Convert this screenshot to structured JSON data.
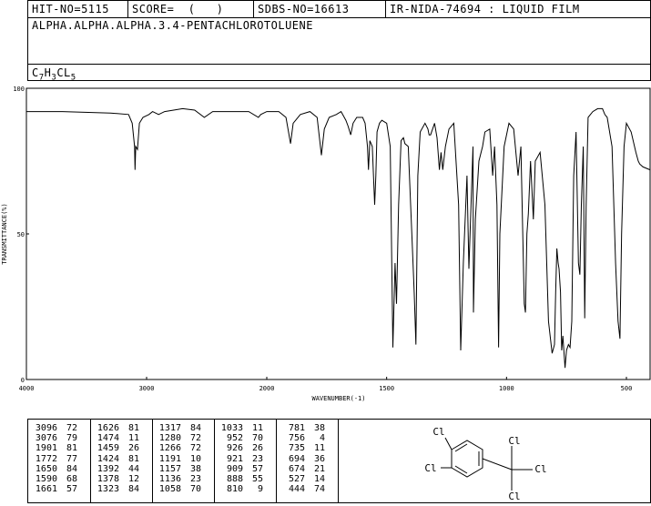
{
  "header": {
    "hit_no": "HIT-NO=5115",
    "score": "SCORE=  (   )",
    "sdbs_no": "SDBS-NO=16613",
    "ir_nida": "IR-NIDA-74694 : LIQUID FILM"
  },
  "compound_name": "ALPHA.ALPHA.ALPHA.3.4-PENTACHLOROTOLUENE",
  "formula": {
    "c": "C",
    "c_n": "7",
    "h": "H",
    "h_n": "3",
    "cl": "CL",
    "cl_n": "5"
  },
  "chart_data": {
    "type": "line",
    "xlabel": "WAVENUMBER(-1)",
    "ylabel": "TRANSMITTANCE(%)",
    "xlim": [
      4000,
      400
    ],
    "ylim": [
      0,
      100
    ],
    "x_ticks": [
      4000,
      3000,
      2000,
      1500,
      1000,
      500
    ],
    "y_ticks": [
      0,
      50,
      100
    ],
    "x_tick_labels": [
      "4000",
      "3000",
      "2000",
      "1500",
      "1000",
      "500"
    ],
    "y_tick_labels": [
      "0",
      "50",
      "100"
    ],
    "series": [
      {
        "points": [
          [
            4000,
            92
          ],
          [
            3700,
            92
          ],
          [
            3300,
            91.5
          ],
          [
            3150,
            91
          ],
          [
            3120,
            88
          ],
          [
            3100,
            80
          ],
          [
            3096,
            72
          ],
          [
            3090,
            80
          ],
          [
            3076,
            79
          ],
          [
            3060,
            88
          ],
          [
            3030,
            90
          ],
          [
            2980,
            91
          ],
          [
            2950,
            92
          ],
          [
            2900,
            91
          ],
          [
            2850,
            92
          ],
          [
            2700,
            93
          ],
          [
            2600,
            92.5
          ],
          [
            2520,
            90
          ],
          [
            2450,
            92
          ],
          [
            2300,
            92
          ],
          [
            2150,
            92
          ],
          [
            2070,
            90
          ],
          [
            2050,
            91
          ],
          [
            2000,
            92
          ],
          [
            1950,
            92
          ],
          [
            1920,
            90
          ],
          [
            1901,
            81
          ],
          [
            1890,
            88
          ],
          [
            1860,
            91
          ],
          [
            1820,
            92
          ],
          [
            1790,
            90
          ],
          [
            1772,
            77
          ],
          [
            1760,
            86
          ],
          [
            1740,
            90
          ],
          [
            1710,
            91
          ],
          [
            1690,
            92
          ],
          [
            1670,
            89
          ],
          [
            1661,
            87
          ],
          [
            1650,
            84
          ],
          [
            1640,
            88
          ],
          [
            1625,
            90
          ],
          [
            1600,
            90
          ],
          [
            1590,
            88
          ],
          [
            1580,
            80
          ],
          [
            1576,
            72
          ],
          [
            1570,
            82
          ],
          [
            1560,
            80
          ],
          [
            1550,
            60
          ],
          [
            1545,
            70
          ],
          [
            1540,
            85
          ],
          [
            1530,
            88
          ],
          [
            1520,
            89
          ],
          [
            1500,
            88
          ],
          [
            1485,
            80
          ],
          [
            1474,
            11
          ],
          [
            1465,
            40
          ],
          [
            1459,
            26
          ],
          [
            1450,
            60
          ],
          [
            1440,
            82
          ],
          [
            1430,
            83
          ],
          [
            1424,
            81
          ],
          [
            1410,
            80
          ],
          [
            1400,
            60
          ],
          [
            1392,
            44
          ],
          [
            1385,
            30
          ],
          [
            1378,
            12
          ],
          [
            1370,
            70
          ],
          [
            1360,
            85
          ],
          [
            1340,
            88
          ],
          [
            1328,
            86
          ],
          [
            1323,
            84
          ],
          [
            1317,
            84
          ],
          [
            1300,
            88
          ],
          [
            1290,
            83
          ],
          [
            1280,
            72
          ],
          [
            1273,
            78
          ],
          [
            1266,
            72
          ],
          [
            1255,
            80
          ],
          [
            1240,
            86
          ],
          [
            1220,
            88
          ],
          [
            1200,
            60
          ],
          [
            1191,
            10
          ],
          [
            1180,
            40
          ],
          [
            1165,
            70
          ],
          [
            1157,
            38
          ],
          [
            1150,
            55
          ],
          [
            1140,
            80
          ],
          [
            1138,
            23
          ],
          [
            1130,
            55
          ],
          [
            1115,
            75
          ],
          [
            1100,
            80
          ],
          [
            1090,
            85
          ],
          [
            1070,
            86
          ],
          [
            1058,
            70
          ],
          [
            1050,
            80
          ],
          [
            1040,
            60
          ],
          [
            1033,
            11
          ],
          [
            1028,
            50
          ],
          [
            1010,
            80
          ],
          [
            990,
            88
          ],
          [
            970,
            86
          ],
          [
            952,
            70
          ],
          [
            940,
            80
          ],
          [
            926,
            26
          ],
          [
            921,
            23
          ],
          [
            915,
            50
          ],
          [
            909,
            57
          ],
          [
            900,
            75
          ],
          [
            888,
            55
          ],
          [
            880,
            75
          ],
          [
            860,
            78
          ],
          [
            840,
            60
          ],
          [
            825,
            20
          ],
          [
            810,
            9
          ],
          [
            800,
            12
          ],
          [
            795,
            30
          ],
          [
            790,
            45
          ],
          [
            785,
            40
          ],
          [
            781,
            38
          ],
          [
            775,
            30
          ],
          [
            770,
            10
          ],
          [
            765,
            15
          ],
          [
            756,
            4
          ],
          [
            750,
            10
          ],
          [
            742,
            12
          ],
          [
            735,
            11
          ],
          [
            728,
            20
          ],
          [
            720,
            70
          ],
          [
            710,
            85
          ],
          [
            700,
            40
          ],
          [
            694,
            36
          ],
          [
            688,
            60
          ],
          [
            680,
            80
          ],
          [
            674,
            21
          ],
          [
            668,
            60
          ],
          [
            660,
            90
          ],
          [
            640,
            92
          ],
          [
            620,
            93
          ],
          [
            600,
            93
          ],
          [
            590,
            91
          ],
          [
            580,
            90
          ],
          [
            560,
            80
          ],
          [
            545,
            40
          ],
          [
            535,
            20
          ],
          [
            527,
            14
          ],
          [
            520,
            50
          ],
          [
            510,
            80
          ],
          [
            500,
            88
          ],
          [
            480,
            85
          ],
          [
            460,
            78
          ],
          [
            450,
            75
          ],
          [
            444,
            74
          ],
          [
            430,
            73
          ],
          [
            400,
            72
          ]
        ]
      }
    ],
    "peak_table": [
      [
        3096,
        72
      ],
      [
        3076,
        79
      ],
      [
        1901,
        81
      ],
      [
        1772,
        77
      ],
      [
        1650,
        84
      ],
      [
        1590,
        68
      ],
      [
        1661,
        57
      ],
      [
        1626,
        81
      ],
      [
        1474,
        11
      ],
      [
        1459,
        26
      ],
      [
        1424,
        81
      ],
      [
        1392,
        44
      ],
      [
        1378,
        12
      ],
      [
        1323,
        84
      ],
      [
        1317,
        84
      ],
      [
        1280,
        72
      ],
      [
        1266,
        72
      ],
      [
        1191,
        10
      ],
      [
        1157,
        38
      ],
      [
        1138,
        23
      ],
      [
        1058,
        70
      ],
      [
        1033,
        11
      ],
      [
        952,
        70
      ],
      [
        926,
        26
      ],
      [
        921,
        23
      ],
      [
        909,
        57
      ],
      [
        888,
        55
      ],
      [
        810,
        9
      ],
      [
        781,
        38
      ],
      [
        756,
        4
      ],
      [
        735,
        11
      ],
      [
        694,
        36
      ],
      [
        674,
        21
      ],
      [
        527,
        14
      ],
      [
        444,
        74
      ]
    ]
  },
  "peak_columns": [
    {
      "wn": [
        "3096",
        "3076",
        "1901",
        "1772",
        "1650",
        "1590",
        "1661"
      ],
      "t": [
        "72",
        "79",
        "81",
        "77",
        "84",
        "68",
        "57"
      ]
    },
    {
      "wn": [
        "1626",
        "1474",
        "1459",
        "1424",
        "1392",
        "1378",
        "1323"
      ],
      "t": [
        "81",
        "11",
        "26",
        "81",
        "44",
        "12",
        "84"
      ]
    },
    {
      "wn": [
        "1317",
        "1280",
        "1266",
        "1191",
        "1157",
        "1136",
        "1058"
      ],
      "t": [
        "84",
        "72",
        "72",
        "10",
        "38",
        "23",
        "70"
      ]
    },
    {
      "wn": [
        "1033",
        "952",
        "926",
        "921",
        "909",
        "888",
        "810"
      ],
      "t": [
        "11",
        "70",
        "26",
        "23",
        "57",
        "55",
        "9"
      ]
    },
    {
      "wn": [
        "781",
        "756",
        "735",
        "694",
        "674",
        "527",
        "444"
      ],
      "t": [
        "38",
        "4",
        "11",
        "36",
        "21",
        "14",
        "74"
      ]
    }
  ],
  "structure": {
    "cl_ring_meta": "Cl",
    "cl_ring_para": "Cl",
    "ccl3_top": "Cl",
    "ccl3_right": "Cl",
    "ccl3_bottom": "Cl"
  }
}
